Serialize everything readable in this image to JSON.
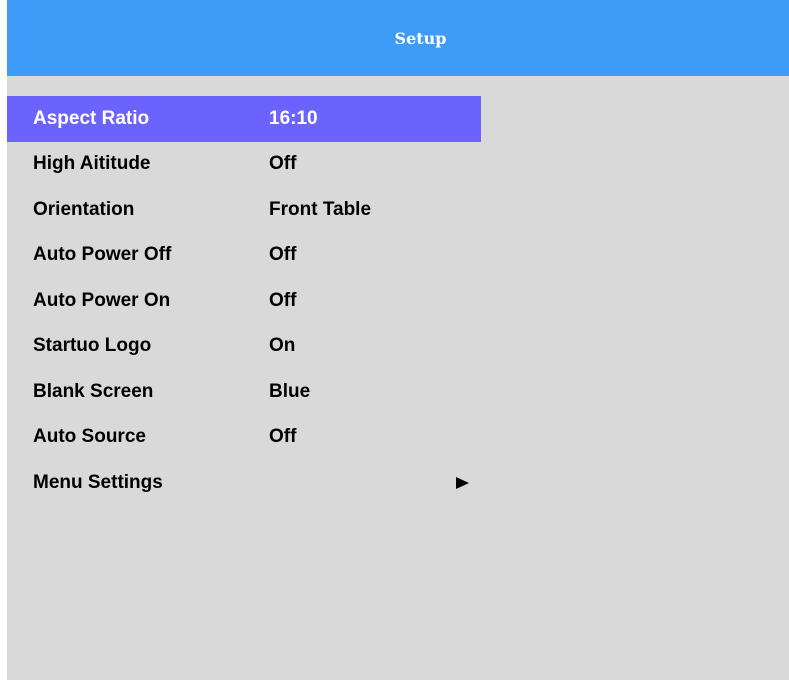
{
  "header": {
    "title": "Setup"
  },
  "colors": {
    "header_bg": "#3d9cf7",
    "panel_bg": "#d9d9d9",
    "selection_bg": "#6c63ff"
  },
  "menu": {
    "items": [
      {
        "label": "Aspect Ratio",
        "value": "16:10",
        "selected": true
      },
      {
        "label": "High Aititude",
        "value": "Off"
      },
      {
        "label": "Orientation",
        "value": "Front Table"
      },
      {
        "label": "Auto Power Off",
        "value": "Off"
      },
      {
        "label": "Auto Power On",
        "value": "Off"
      },
      {
        "label": "Startuo Logo",
        "value": "On"
      },
      {
        "label": "Blank Screen",
        "value": "Blue"
      },
      {
        "label": "Auto Source",
        "value": "Off"
      },
      {
        "label": "Menu Settings",
        "value": "",
        "icon": "right-triangle-arrow-icon"
      }
    ]
  }
}
